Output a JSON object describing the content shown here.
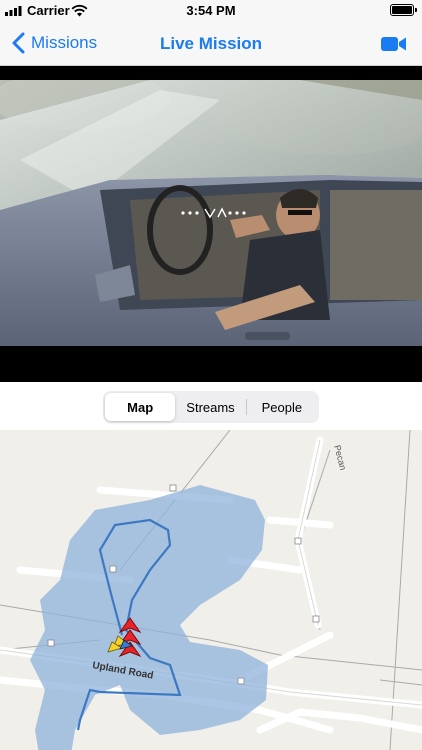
{
  "status": {
    "carrier": "Carrier",
    "time": "3:54 PM"
  },
  "nav": {
    "back_label": "Missions",
    "title": "Live Mission",
    "accent": "#1a7bf2"
  },
  "segments": {
    "items": [
      {
        "label": "Map",
        "active": true
      },
      {
        "label": "Streams",
        "active": false
      },
      {
        "label": "People",
        "active": false
      }
    ]
  },
  "map": {
    "road_label": "Upland Road",
    "street_label": "Pecan",
    "coverage_color": "#8fb3db",
    "track_color": "#3d78c2"
  }
}
